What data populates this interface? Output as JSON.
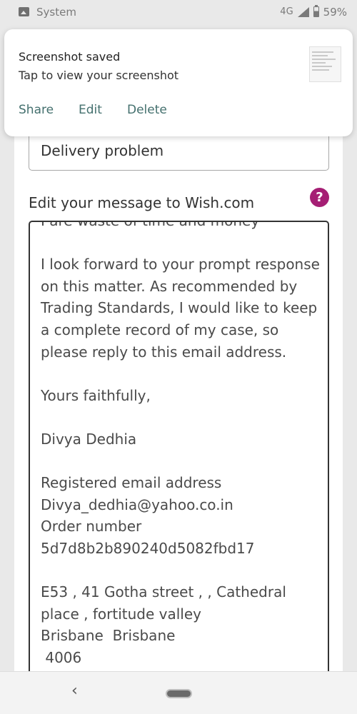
{
  "status_bar": {
    "app_name": "System",
    "network": "4G",
    "battery": "59%",
    "battery_level": 0.59
  },
  "notification": {
    "title": "Screenshot saved",
    "text": "Tap to view your screenshot",
    "actions": [
      "Share",
      "Edit",
      "Delete"
    ]
  },
  "form": {
    "subject_value": "Delivery problem",
    "message_label": "Edit your message to Wish.com",
    "help_icon": "?",
    "message_text": "I are waste of time and money\n\nI look forward to your prompt response on this matter. As recommended by Trading Standards, I would like to keep a complete record of my case, so please reply to this email address.\n\nYours faithfully,\n\nDivya Dedhia\n\nRegistered email address\nDivya_dedhia@yahoo.co.in\nOrder number\n5d7d8b2b890240d5082fbd17\n\nE53 , 41 Gotha street , , Cathedral place , fortitude valley\nBrisbane  Brisbane\n 4006"
  },
  "nav": {
    "back_glyph": "‹"
  },
  "icons": {
    "app": "image-icon",
    "signal": "signal-icon",
    "battery": "battery-icon",
    "help": "help-icon",
    "back": "back-icon",
    "home": "home-pill-icon"
  },
  "colors": {
    "accent_action": "#44706e",
    "help_icon": "#a51e74"
  }
}
